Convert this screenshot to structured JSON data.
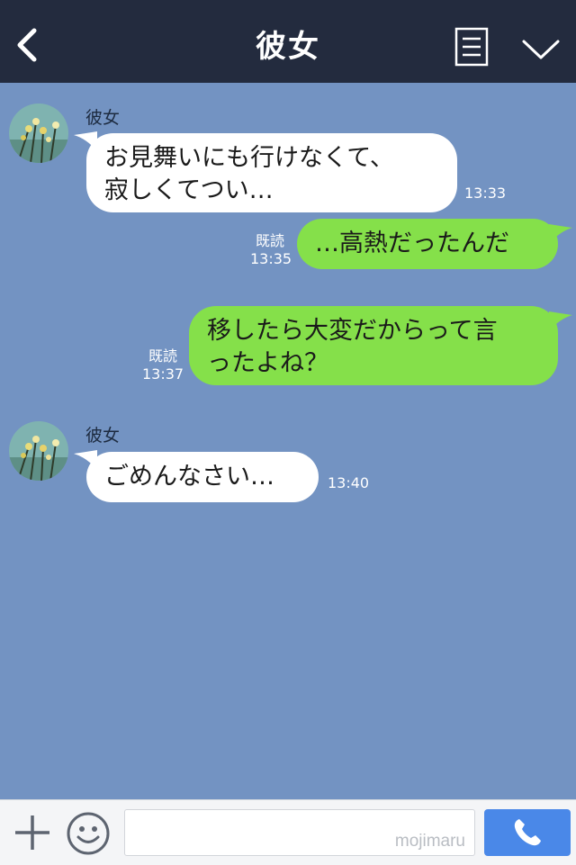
{
  "header": {
    "title": "彼女"
  },
  "messages": [
    {
      "side": "left",
      "sender": "彼女",
      "lines": [
        "お見舞いにも行けなくて、",
        "寂しくてつい…"
      ],
      "time": "13:33"
    },
    {
      "side": "right",
      "read": "既読",
      "lines": [
        "…高熱だったんだ"
      ],
      "time": "13:35"
    },
    {
      "side": "right",
      "read": "既読",
      "lines": [
        "移したら大変だからって言",
        "ったよね？"
      ],
      "time": "13:37"
    },
    {
      "side": "left",
      "sender": "彼女",
      "lines": [
        "ごめんなさい…"
      ],
      "time": "13:40"
    }
  ],
  "footer": {
    "watermark": "mojimaru"
  },
  "colors": {
    "background": "#7393c2",
    "header": "#232b3e",
    "sent_bubble": "#85e04a",
    "received_bubble": "#ffffff",
    "call_button": "#4a88e8"
  },
  "icons": {
    "back": "chevron-left-icon",
    "menu": "list-icon",
    "collapse": "chevron-down-icon",
    "add": "plus-icon",
    "emoji": "smile-icon",
    "call": "phone-icon"
  }
}
